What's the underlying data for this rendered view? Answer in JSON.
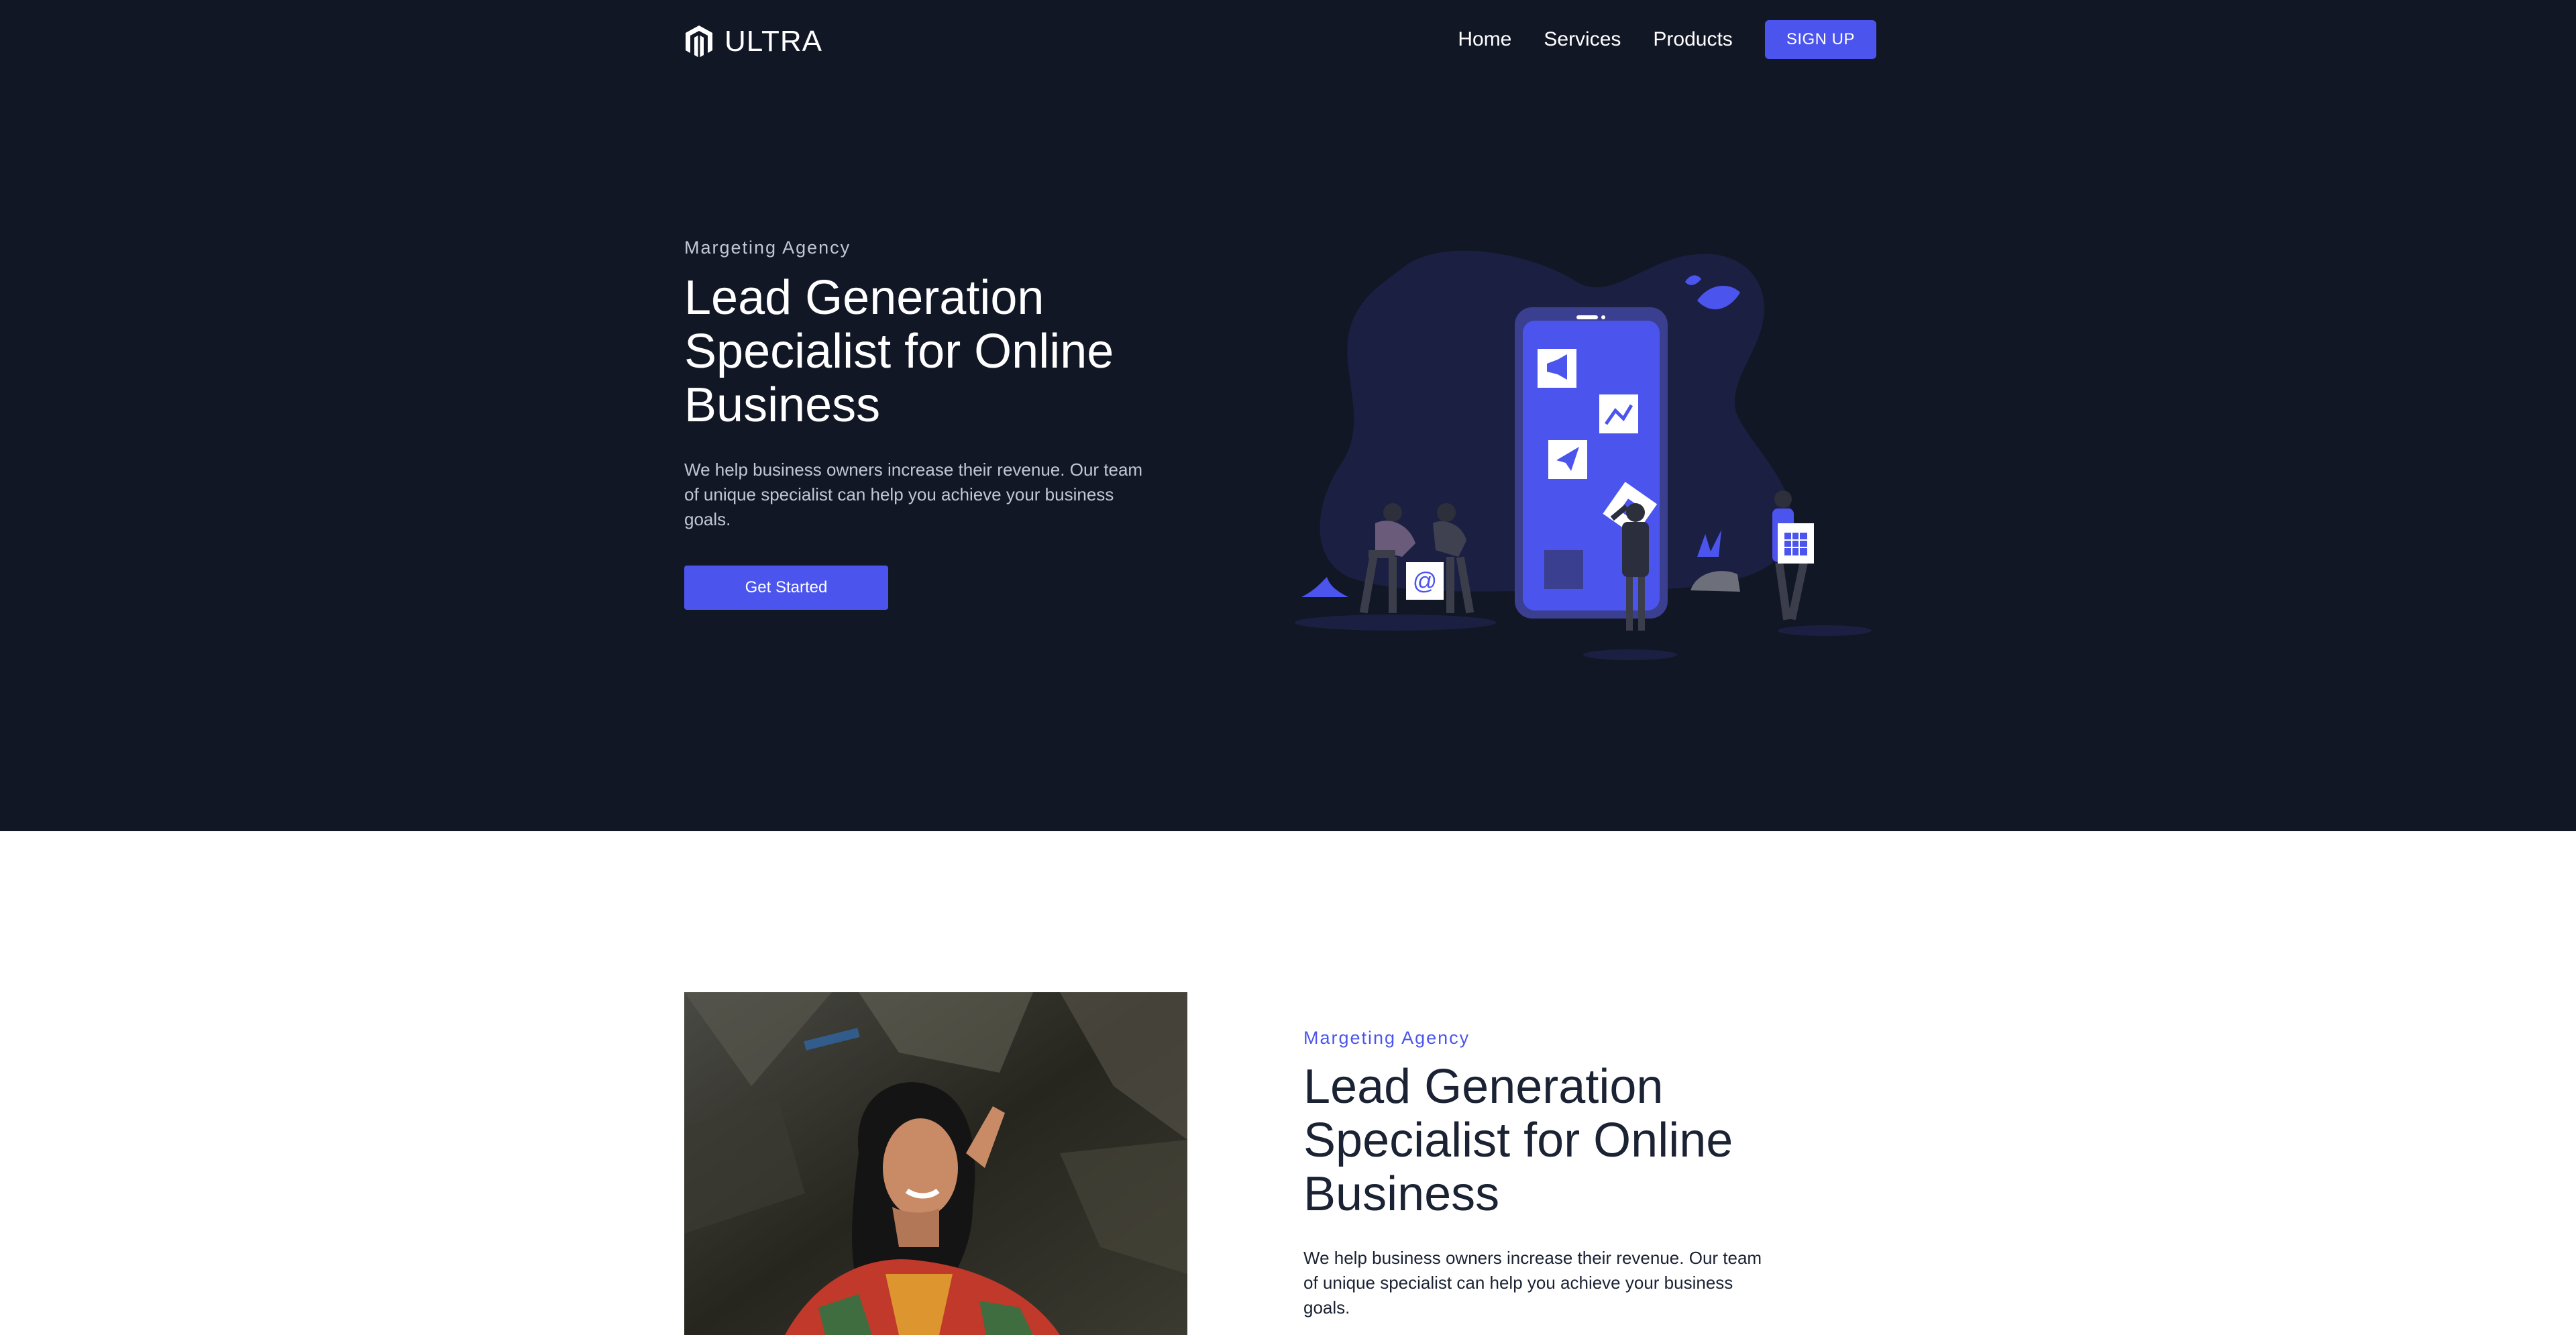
{
  "nav": {
    "brand": "ULTRA",
    "links": [
      "Home",
      "Services",
      "Products"
    ],
    "signup_label": "SIGN UP"
  },
  "hero": {
    "eyebrow": "Margeting Agency",
    "title_lines": [
      "Lead Generation",
      "Specialist for Online",
      "Business"
    ],
    "description_lines": [
      "We help business owners increase their revenue. Our team",
      "of unique specialist can help you achieve your business",
      "goals."
    ],
    "cta_label": "Get Started"
  },
  "feature": {
    "eyebrow": "Margeting Agency",
    "title_lines": [
      "Lead Generation",
      "Specialist for Online",
      "Business"
    ],
    "description_lines": [
      "We help business owners increase their revenue. Our team",
      "of unique specialist can help you achieve your business",
      "goals."
    ]
  },
  "illustration": {
    "email_glyph": "@"
  },
  "colors": {
    "hero_bg": "#121726",
    "accent": "#4b55ee",
    "blob": "#1b2042",
    "white_section_eyebrow": "#4b55ee",
    "dark_text": "#1a2233"
  },
  "icons": [
    "ultra-logo-icon",
    "megaphone-icon",
    "chart-icon",
    "paper-plane-icon",
    "email-icon",
    "calendar-icon",
    "leaf-icon"
  ]
}
